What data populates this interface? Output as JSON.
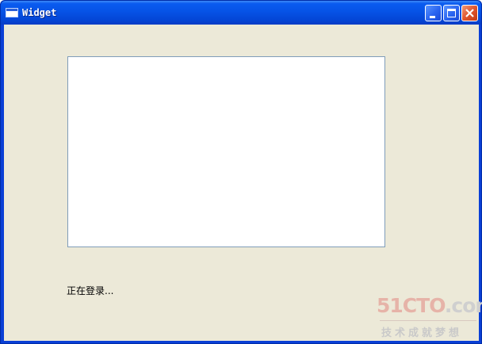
{
  "window": {
    "title": "Widget",
    "title_icon": "window-app-icon"
  },
  "titlebar_buttons": {
    "minimize_icon": "minimize-icon",
    "maximize_icon": "maximize-icon",
    "close_icon": "close-icon"
  },
  "content": {
    "status_text": "正在登录..."
  },
  "watermark": {
    "brand_prefix": "51CTO",
    "brand_suffix": ".com",
    "tagline": "技术成就梦想"
  },
  "colors": {
    "titlebar": "#0653e6",
    "client_background": "#ece9d8",
    "frame_border": "#7f9db9",
    "close_button": "#e0552e"
  }
}
